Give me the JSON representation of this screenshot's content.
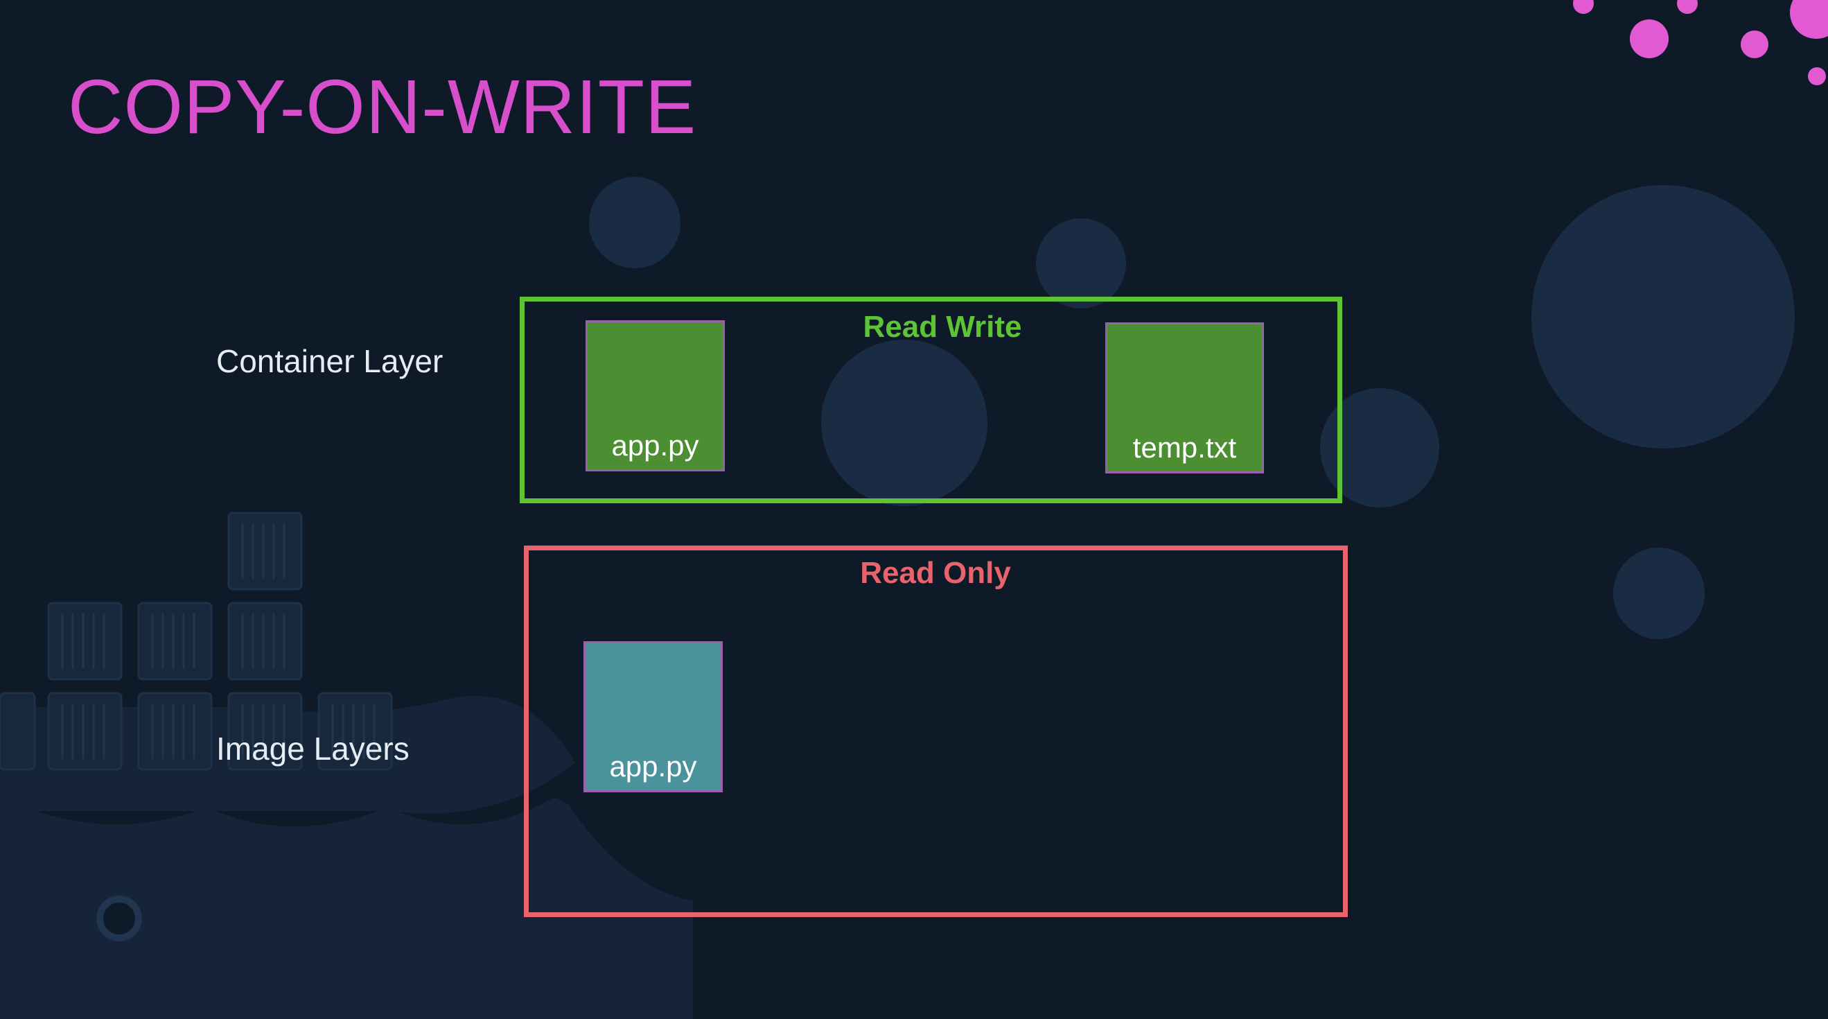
{
  "title": "COPY-ON-WRITE",
  "labels": {
    "container_layer": "Container Layer",
    "image_layers": "Image Layers"
  },
  "container_box": {
    "label": "Read Write",
    "border_color": "#5dc436",
    "files": [
      "app.py",
      "temp.txt"
    ]
  },
  "image_box": {
    "label": "Read Only",
    "border_color": "#e8636b",
    "files": [
      "app.py"
    ]
  },
  "colors": {
    "background": "#0f1a29",
    "title": "#d84fcb",
    "read_write_file": "#4c8f33",
    "read_only_file": "#4a929c",
    "file_border": "#9b5fb0",
    "accent_dots": "#e25ad1"
  }
}
